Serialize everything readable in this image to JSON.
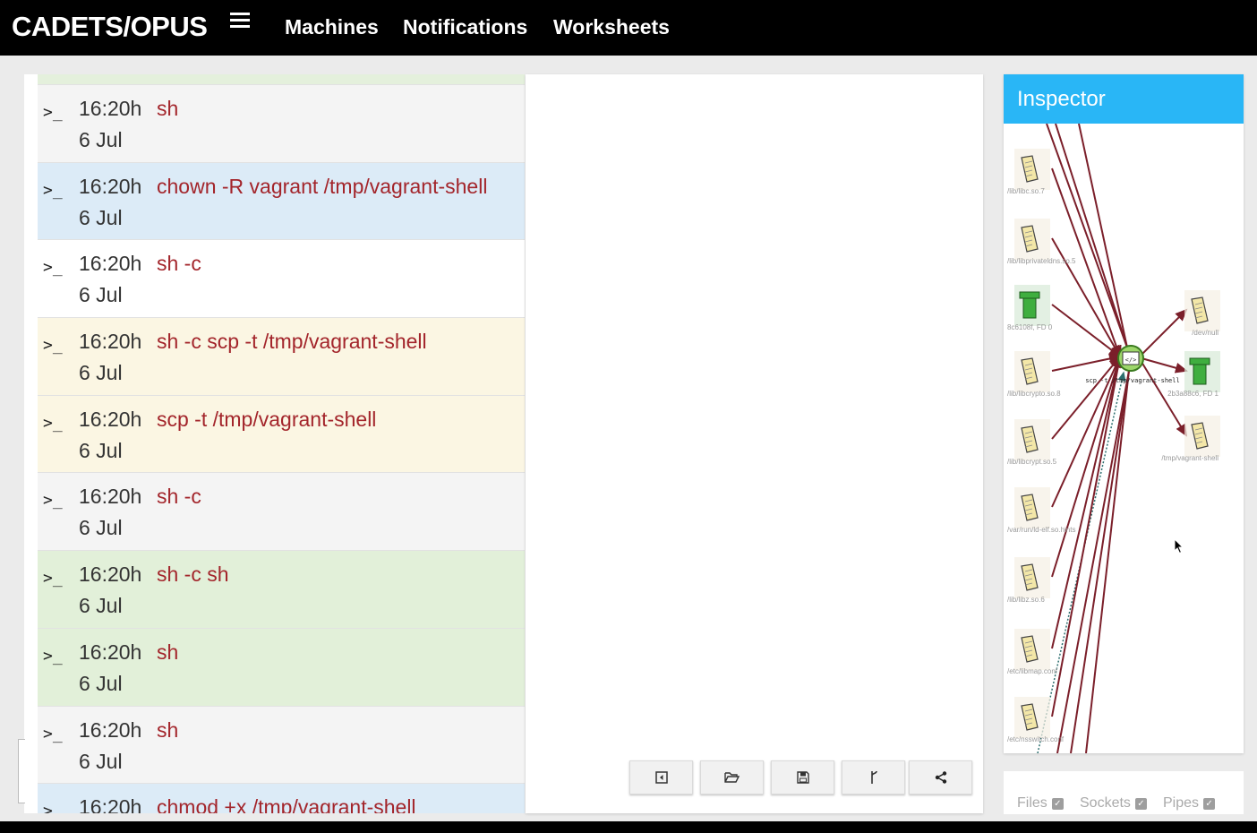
{
  "app": {
    "title": "CADETS/OPUS"
  },
  "nav": {
    "machines": "Machines",
    "notifications": "Notifications",
    "worksheets": "Worksheets"
  },
  "commands": [
    {
      "prompt": ">_",
      "time": "16:20h",
      "date": "6 Jul",
      "cmd": "sh",
      "bg": "grey"
    },
    {
      "prompt": ">_",
      "time": "16:20h",
      "date": "6 Jul",
      "cmd": "chown -R vagrant /tmp/vagrant-shell",
      "bg": "blue"
    },
    {
      "prompt": ">_",
      "time": "16:20h",
      "date": "6 Jul",
      "cmd": "sh -c",
      "bg": "white"
    },
    {
      "prompt": ">_",
      "time": "16:20h",
      "date": "6 Jul",
      "cmd": "sh -c scp -t /tmp/vagrant-shell",
      "bg": "yellow"
    },
    {
      "prompt": ">_",
      "time": "16:20h",
      "date": "6 Jul",
      "cmd": "scp -t /tmp/vagrant-shell",
      "bg": "yellow"
    },
    {
      "prompt": ">_",
      "time": "16:20h",
      "date": "6 Jul",
      "cmd": "sh -c",
      "bg": "grey"
    },
    {
      "prompt": ">_",
      "time": "16:20h",
      "date": "6 Jul",
      "cmd": "sh -c sh",
      "bg": "green"
    },
    {
      "prompt": ">_",
      "time": "16:20h",
      "date": "6 Jul",
      "cmd": "sh",
      "bg": "green"
    },
    {
      "prompt": ">_",
      "time": "16:20h",
      "date": "6 Jul",
      "cmd": "sh",
      "bg": "grey"
    },
    {
      "prompt": ">_",
      "time": "16:20h",
      "date": "",
      "cmd": "chmod +x /tmp/vagrant-shell",
      "bg": "blue"
    }
  ],
  "toolbar": [
    "back-icon",
    "folder-open-icon",
    "save-icon",
    "fork-icon",
    "share-icon"
  ],
  "inspector": {
    "title": "Inspector",
    "center_label": "scp -t /tmp/vagrant-shell",
    "left_nodes": [
      {
        "label": "/lib/libc.so.7",
        "kind": "file"
      },
      {
        "label": "/lib/libprivateldns.so.5",
        "kind": "file"
      },
      {
        "label": "8c6108f, FD 0",
        "kind": "pipe"
      },
      {
        "label": "/lib/libcrypto.so.8",
        "kind": "file"
      },
      {
        "label": "/lib/libcrypt.so.5",
        "kind": "file"
      },
      {
        "label": "/var/run/ld-elf.so.hints",
        "kind": "file"
      },
      {
        "label": "/lib/libz.so.6",
        "kind": "file"
      },
      {
        "label": "/etc/libmap.conf",
        "kind": "file"
      },
      {
        "label": "/etc/nsswitch.conf",
        "kind": "file"
      }
    ],
    "right_nodes": [
      {
        "label": "/dev/null",
        "kind": "file"
      },
      {
        "label": "2b3a88c6, FD 1",
        "kind": "pipe"
      },
      {
        "label": "/tmp/vagrant-shell",
        "kind": "file"
      }
    ]
  },
  "filters": [
    {
      "label": "Files",
      "checked": true
    },
    {
      "label": "Sockets",
      "checked": true
    },
    {
      "label": "Pipes",
      "checked": true
    }
  ],
  "colors": {
    "edge": "#7b1f2a",
    "accent": "#29b6f6",
    "pipe": "#3fae3f",
    "file": "#f3e7a8"
  }
}
